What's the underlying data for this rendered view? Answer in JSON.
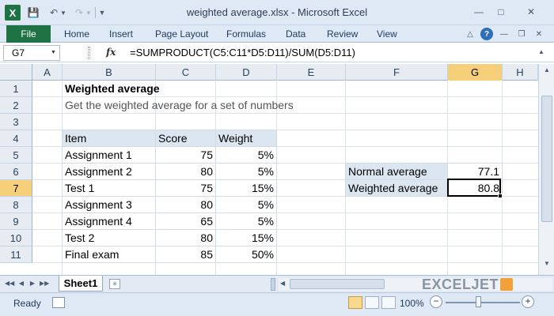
{
  "window": {
    "title": "weighted average.xlsx - Microsoft Excel",
    "app_icon": "X",
    "accent": "#1f7244"
  },
  "quick_access": {
    "icons": [
      "excel-icon",
      "save-icon",
      "undo-icon",
      "redo-icon",
      "customize-icon"
    ]
  },
  "ribbon": {
    "file_label": "File",
    "tabs": [
      "Home",
      "Insert",
      "Page Layout",
      "Formulas",
      "Data",
      "Review",
      "View"
    ]
  },
  "formula_bar": {
    "name_box": "G7",
    "fx": "fx",
    "formula": "=SUMPRODUCT(C5:C11*D5:D11)/SUM(D5:D11)"
  },
  "grid": {
    "columns": [
      "A",
      "B",
      "C",
      "D",
      "E",
      "F",
      "G",
      "H"
    ],
    "selected_column": "G",
    "rows": [
      "1",
      "2",
      "3",
      "4",
      "5",
      "6",
      "7",
      "8",
      "9",
      "10",
      "11"
    ],
    "selected_row": "7"
  },
  "sheet": {
    "title": "Weighted average",
    "subtitle": "Get the weighted average for a set of numbers",
    "table_headers": [
      "Item",
      "Score",
      "Weight"
    ],
    "table_rows": [
      [
        "Assignment 1",
        "75",
        "5%"
      ],
      [
        "Assignment 2",
        "80",
        "5%"
      ],
      [
        "Test 1",
        "75",
        "15%"
      ],
      [
        "Assignment 3",
        "80",
        "5%"
      ],
      [
        "Assignment 4",
        "65",
        "5%"
      ],
      [
        "Test 2",
        "80",
        "15%"
      ],
      [
        "Final exam",
        "85",
        "50%"
      ]
    ],
    "summary": [
      {
        "label": "Normal average",
        "value": "77.1"
      },
      {
        "label": "Weighted average",
        "value": "80.8"
      }
    ]
  },
  "sheet_tabs": {
    "active": "Sheet1"
  },
  "branding": {
    "logo_text": "EXCELJET"
  },
  "status": {
    "text": "Ready",
    "zoom": "100%"
  }
}
